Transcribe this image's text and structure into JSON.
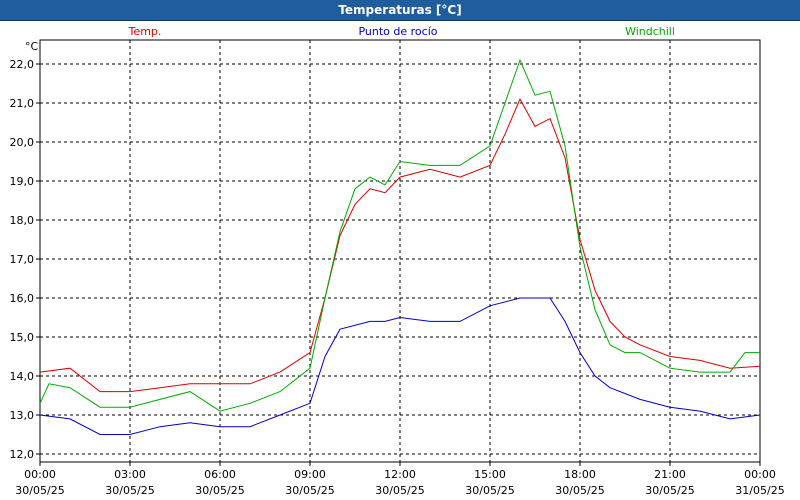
{
  "window": {
    "title": "Temperaturas [°C]"
  },
  "chart_data": {
    "type": "line",
    "title": "Temperaturas [°C]",
    "ylabel": "°C",
    "ylim": [
      12.0,
      22.0
    ],
    "y_ticks": [
      "12,0",
      "13,0",
      "14,0",
      "15,0",
      "16,0",
      "17,0",
      "18,0",
      "19,0",
      "20,0",
      "21,0",
      "22,0"
    ],
    "x_ticks": [
      {
        "time": "00:00",
        "date": "30/05/25"
      },
      {
        "time": "03:00",
        "date": "30/05/25"
      },
      {
        "time": "06:00",
        "date": "30/05/25"
      },
      {
        "time": "09:00",
        "date": "30/05/25"
      },
      {
        "time": "12:00",
        "date": "30/05/25"
      },
      {
        "time": "15:00",
        "date": "30/05/25"
      },
      {
        "time": "18:00",
        "date": "30/05/25"
      },
      {
        "time": "21:00",
        "date": "30/05/25"
      },
      {
        "time": "00:00",
        "date": "31/05/25"
      }
    ],
    "x_unit": "hours",
    "grid": true,
    "legend": "top",
    "series": [
      {
        "name": "Temp.",
        "color": "#dd0000",
        "points": [
          [
            0,
            14.1
          ],
          [
            1,
            14.2
          ],
          [
            2,
            13.6
          ],
          [
            3,
            13.6
          ],
          [
            4,
            13.7
          ],
          [
            5,
            13.8
          ],
          [
            6,
            13.8
          ],
          [
            7,
            13.8
          ],
          [
            8,
            14.1
          ],
          [
            9,
            14.6
          ],
          [
            9.5,
            16.0
          ],
          [
            10,
            17.6
          ],
          [
            10.5,
            18.4
          ],
          [
            11,
            18.8
          ],
          [
            11.5,
            18.7
          ],
          [
            12,
            19.1
          ],
          [
            13,
            19.3
          ],
          [
            14,
            19.1
          ],
          [
            15,
            19.4
          ],
          [
            15.5,
            20.2
          ],
          [
            16,
            21.1
          ],
          [
            16.5,
            20.4
          ],
          [
            17,
            20.6
          ],
          [
            17.5,
            19.6
          ],
          [
            18,
            17.5
          ],
          [
            18.5,
            16.2
          ],
          [
            19,
            15.4
          ],
          [
            19.5,
            15.0
          ],
          [
            20,
            14.8
          ],
          [
            21,
            14.5
          ],
          [
            22,
            14.4
          ],
          [
            23,
            14.2
          ],
          [
            24,
            14.25
          ]
        ]
      },
      {
        "name": "Punto de rocío",
        "color": "#0000cc",
        "points": [
          [
            0,
            13.0
          ],
          [
            1,
            12.9
          ],
          [
            2,
            12.5
          ],
          [
            3,
            12.5
          ],
          [
            4,
            12.7
          ],
          [
            5,
            12.8
          ],
          [
            6,
            12.7
          ],
          [
            7,
            12.7
          ],
          [
            8,
            13.0
          ],
          [
            9,
            13.3
          ],
          [
            9.5,
            14.5
          ],
          [
            10,
            15.2
          ],
          [
            11,
            15.4
          ],
          [
            11.5,
            15.4
          ],
          [
            12,
            15.5
          ],
          [
            13,
            15.4
          ],
          [
            14,
            15.4
          ],
          [
            15,
            15.8
          ],
          [
            16,
            16.0
          ],
          [
            17,
            16.0
          ],
          [
            17.5,
            15.4
          ],
          [
            18,
            14.6
          ],
          [
            18.5,
            14.0
          ],
          [
            19,
            13.7
          ],
          [
            20,
            13.4
          ],
          [
            21,
            13.2
          ],
          [
            22,
            13.1
          ],
          [
            23,
            12.9
          ],
          [
            24,
            13.0
          ]
        ]
      },
      {
        "name": "Windchill",
        "color": "#00aa00",
        "points": [
          [
            0,
            13.3
          ],
          [
            0.3,
            13.8
          ],
          [
            1,
            13.7
          ],
          [
            2,
            13.2
          ],
          [
            3,
            13.2
          ],
          [
            4,
            13.4
          ],
          [
            5,
            13.6
          ],
          [
            6,
            13.1
          ],
          [
            7,
            13.3
          ],
          [
            8,
            13.6
          ],
          [
            9,
            14.2
          ],
          [
            9.5,
            16.0
          ],
          [
            10,
            17.7
          ],
          [
            10.5,
            18.8
          ],
          [
            11,
            19.1
          ],
          [
            11.5,
            18.9
          ],
          [
            12,
            19.5
          ],
          [
            13,
            19.4
          ],
          [
            14,
            19.4
          ],
          [
            15,
            19.9
          ],
          [
            15.5,
            21.0
          ],
          [
            16,
            22.1
          ],
          [
            16.5,
            21.2
          ],
          [
            17,
            21.3
          ],
          [
            17.5,
            19.9
          ],
          [
            18,
            17.3
          ],
          [
            18.5,
            15.7
          ],
          [
            19,
            14.8
          ],
          [
            19.5,
            14.6
          ],
          [
            20,
            14.6
          ],
          [
            21,
            14.2
          ],
          [
            22,
            14.1
          ],
          [
            23,
            14.1
          ],
          [
            23.5,
            14.6
          ],
          [
            24,
            14.6
          ]
        ]
      }
    ]
  }
}
